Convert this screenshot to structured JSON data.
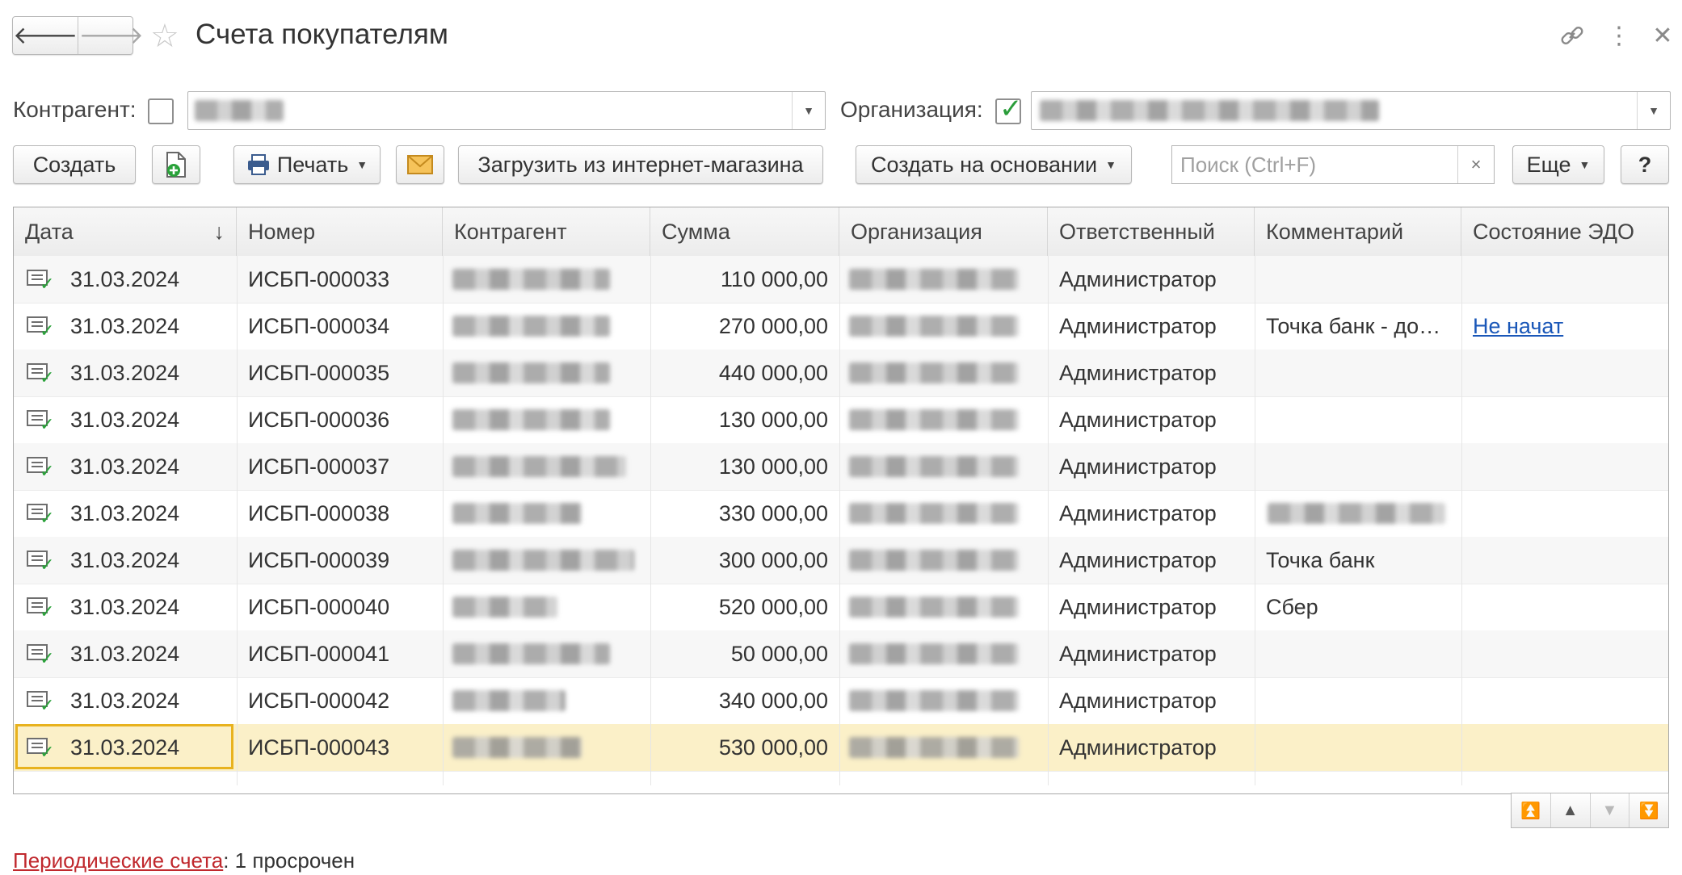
{
  "window": {
    "title": "Счета покупателям",
    "back_icon": "arrow-left-icon",
    "forward_icon": "arrow-right-icon",
    "favorite_icon": "star-icon",
    "link_icon": "link-icon",
    "more_icon": "kebab-icon",
    "close_icon": "close-icon"
  },
  "filters": {
    "counterparty_label": "Контрагент:",
    "counterparty_checked": false,
    "organization_label": "Организация:",
    "organization_checked": true
  },
  "toolbar": {
    "create_label": "Создать",
    "print_label": "Печать",
    "load_label": "Загрузить из интернет-магазина",
    "create_based_label": "Создать на основании",
    "search_placeholder": "Поиск (Ctrl+F)",
    "clear_label": "×",
    "more_label": "Еще",
    "help_label": "?"
  },
  "table": {
    "columns": [
      "Дата",
      "Номер",
      "Контрагент",
      "Сумма",
      "Организация",
      "Ответственный",
      "Комментарий",
      "Состояние ЭДО"
    ],
    "sort_indicator": "↓",
    "rows": [
      {
        "date": "31.03.2024",
        "number": "ИСБП-000033",
        "sum": "110 000,00",
        "responsible": "Администратор",
        "comment": "",
        "edo": ""
      },
      {
        "date": "31.03.2024",
        "number": "ИСБП-000034",
        "sum": "270 000,00",
        "responsible": "Администратор",
        "comment": "Точка банк - до…",
        "edo": "Не начат"
      },
      {
        "date": "31.03.2024",
        "number": "ИСБП-000035",
        "sum": "440 000,00",
        "responsible": "Администратор",
        "comment": "",
        "edo": ""
      },
      {
        "date": "31.03.2024",
        "number": "ИСБП-000036",
        "sum": "130 000,00",
        "responsible": "Администратор",
        "comment": "",
        "edo": ""
      },
      {
        "date": "31.03.2024",
        "number": "ИСБП-000037",
        "sum": "130 000,00",
        "responsible": "Администратор",
        "comment": "",
        "edo": ""
      },
      {
        "date": "31.03.2024",
        "number": "ИСБП-000038",
        "sum": "330 000,00",
        "responsible": "Администратор",
        "comment": "",
        "edo": ""
      },
      {
        "date": "31.03.2024",
        "number": "ИСБП-000039",
        "sum": "300 000,00",
        "responsible": "Администратор",
        "comment": "Точка банк",
        "edo": ""
      },
      {
        "date": "31.03.2024",
        "number": "ИСБП-000040",
        "sum": "520 000,00",
        "responsible": "Администратор",
        "comment": "Сбер",
        "edo": ""
      },
      {
        "date": "31.03.2024",
        "number": "ИСБП-000041",
        "sum": "50 000,00",
        "responsible": "Администратор",
        "comment": "",
        "edo": ""
      },
      {
        "date": "31.03.2024",
        "number": "ИСБП-000042",
        "sum": "340 000,00",
        "responsible": "Администратор",
        "comment": "",
        "edo": ""
      },
      {
        "date": "31.03.2024",
        "number": "ИСБП-000043",
        "sum": "530 000,00",
        "responsible": "Администратор",
        "comment": "",
        "edo": ""
      }
    ],
    "selected_row": "ИСБП-000043"
  },
  "footer": {
    "link_label": "Периодические счета",
    "status_text": ": 1 просрочен"
  },
  "colors": {
    "accent_selection": "#fbf0c8",
    "selection_frame": "#e8b21e",
    "link_blue": "#1a57b8",
    "link_red": "#c0282d",
    "check_green": "#2a9d3a"
  }
}
